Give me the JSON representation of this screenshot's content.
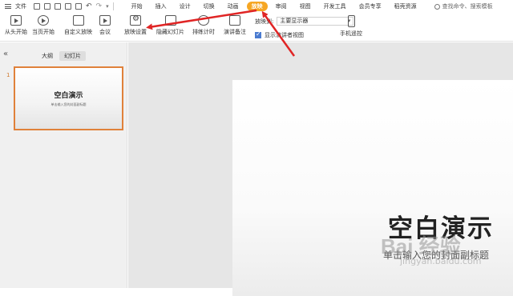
{
  "menubar": {
    "file_label": "文件",
    "tabs": [
      "开始",
      "插入",
      "设计",
      "切换",
      "动画",
      "放映",
      "审阅",
      "视图",
      "开发工具",
      "会员专享",
      "稻壳资源"
    ],
    "active_tab": "放映",
    "search_placeholder": "查找命令、搜索模板"
  },
  "ribbon": {
    "from_start": "从头开始",
    "from_current": "当页开始",
    "custom_show": "自定义放映",
    "meeting": "会议",
    "show_settings": "放映设置",
    "hide_slide": "隐藏幻灯片",
    "rehearse": "排练计时",
    "narration": "演讲备注",
    "show_on_label": "放映到:",
    "show_on_value": "主要显示器",
    "presenter_view_label": "显示演讲者视图",
    "remote": "手机遥控"
  },
  "left_panel": {
    "tab_outline": "大纲",
    "tab_slides": "幻灯片",
    "slide_number": "1",
    "thumb_title": "空白演示",
    "thumb_subtitle": "单击输入您的封面副标题"
  },
  "slide": {
    "title": "空白演示",
    "subtitle": "单击输入您的封面副标题"
  },
  "watermark": {
    "brand": "Bai 经验",
    "url": "jingyan.baidu.com"
  },
  "colors": {
    "accent_tab": "#f6a623",
    "thumb_border": "#e0813a",
    "annotation_arrow": "#e02525"
  }
}
